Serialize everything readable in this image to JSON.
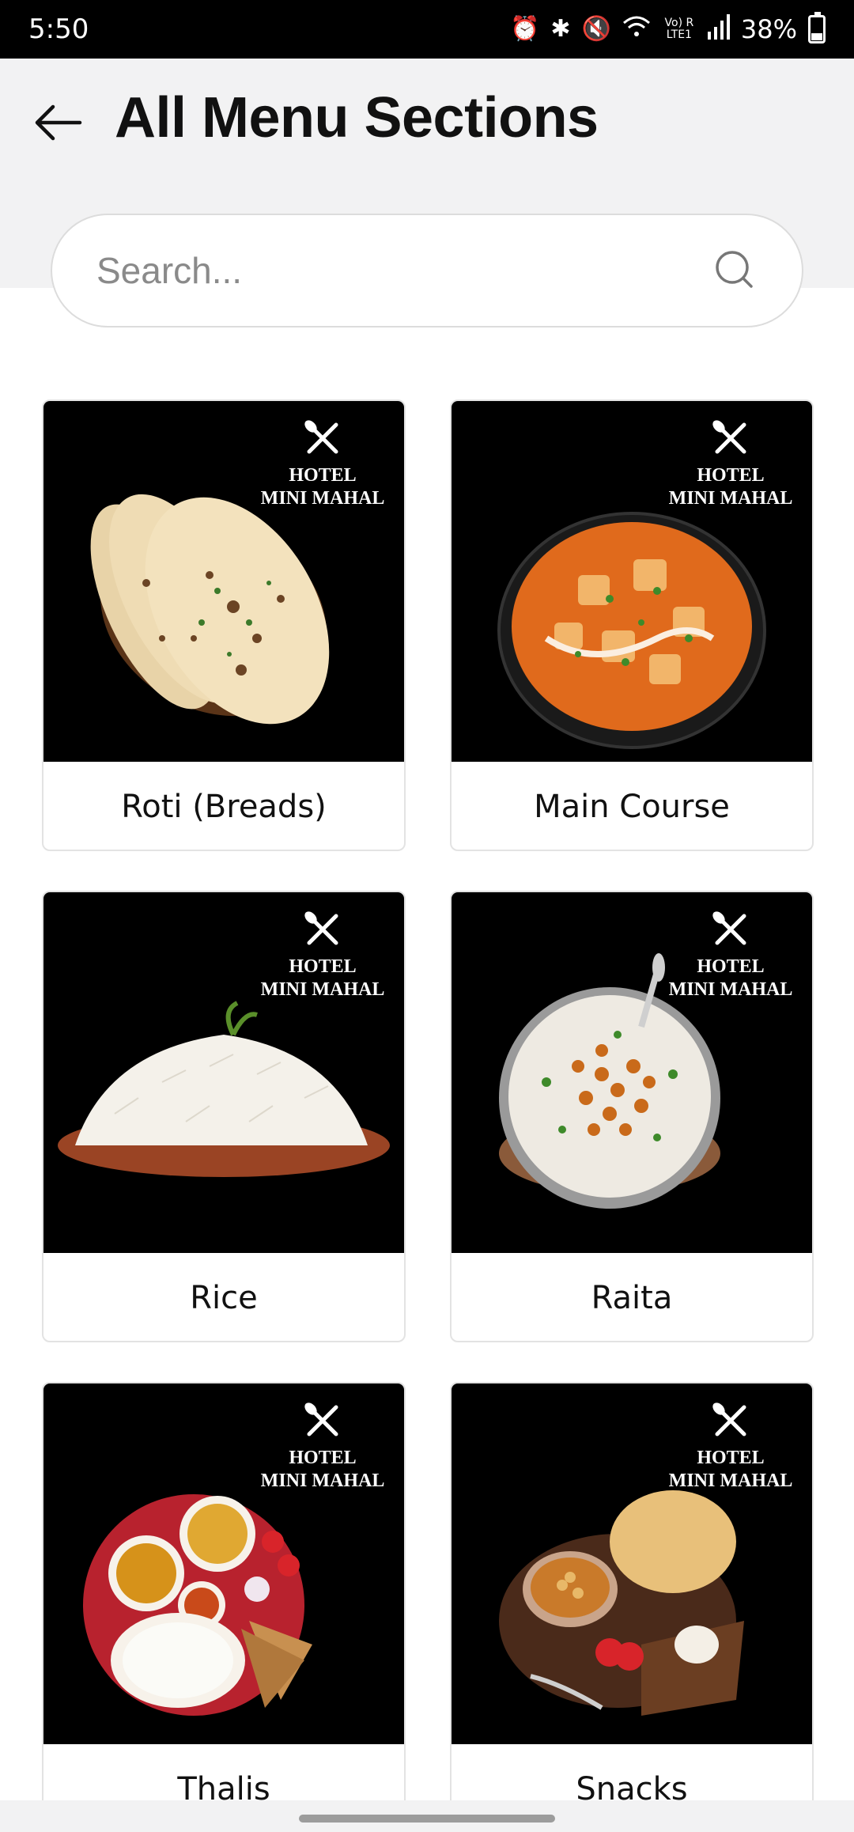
{
  "status_bar": {
    "time": "5:50",
    "battery": "38%",
    "network": "Vo) R LTE1"
  },
  "header": {
    "title": "All Menu Sections"
  },
  "search": {
    "placeholder": "Search..."
  },
  "brand": {
    "line1": "HOTEL",
    "line2": "MINI MAHAL"
  },
  "sections": [
    {
      "label": "Roti (Breads)",
      "image": "naan-bread-basket"
    },
    {
      "label": "Main Course",
      "image": "paneer-curry-bowl"
    },
    {
      "label": "Rice",
      "image": "basmati-rice-plate"
    },
    {
      "label": "Raita",
      "image": "boondi-raita-bowl"
    },
    {
      "label": "Thalis",
      "image": "thali-platter"
    },
    {
      "label": "Snacks",
      "image": "chole-bhature"
    }
  ],
  "colors": {
    "header_bg": "#f2f2f3",
    "status_bar_bg": "#000000",
    "card_image_bg": "#000000",
    "title": "#111111"
  }
}
